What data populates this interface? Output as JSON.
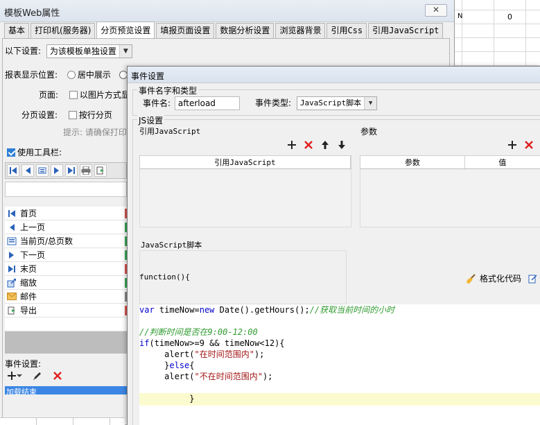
{
  "sheet": {
    "cell_a": "N",
    "cell_b": "0"
  },
  "props_window": {
    "title": "模板Web属性",
    "close_label": "✕",
    "tabs": [
      "基本",
      "打印机(服务器)",
      "分页预览设置",
      "填报页面设置",
      "数据分析设置",
      "浏览器背景",
      "引用Css",
      "引用JavaScript"
    ],
    "active_tab": "分页预览设置",
    "settings_label": "以下设置:",
    "settings_value": "为该模板单独设置",
    "position_label": "报表显示位置:",
    "position_option": "居中展示",
    "page_label": "页面:",
    "page_option": "以图片方式显",
    "paging_label": "分页设置:",
    "paging_option": "按行分页",
    "hint": "提示: 请确保打印",
    "use_toolbar_label": "使用工具栏:",
    "button_list": [
      {
        "label": "首页",
        "icon": "first-page-icon",
        "mark": "#d9534f"
      },
      {
        "label": "上一页",
        "icon": "prev-page-icon",
        "mark": "#3aa757"
      },
      {
        "label": "当前页/总页数",
        "icon": "page-count-icon",
        "mark": "#3aa757"
      },
      {
        "label": "下一页",
        "icon": "next-page-icon",
        "mark": "#3aa757"
      },
      {
        "label": "末页",
        "icon": "last-page-icon",
        "mark": "#d9534f"
      },
      {
        "label": "缩放",
        "icon": "zoom-icon",
        "mark": "#3aa757"
      },
      {
        "label": "邮件",
        "icon": "mail-icon",
        "mark": "#888888"
      },
      {
        "label": "导出",
        "icon": "export-icon",
        "mark": "#d9534f"
      }
    ],
    "event_label": "事件设置:",
    "event_selected": "加载结束"
  },
  "event_dialog": {
    "title": "事件设置",
    "name_type_group": "事件名字和类型",
    "event_name_label": "事件名:",
    "event_name_value": "afterload",
    "event_type_label": "事件类型:",
    "event_type_value": "JavaScript脚本",
    "js_group": "JS设置",
    "ref_js_label": "引用JavaScript",
    "params_label": "参数",
    "ref_js_column": "引用JavaScript",
    "param_column": "参数",
    "value_column": "值",
    "script_label": "JavaScript脚本",
    "function_header": "function(){",
    "format_code_label": "格式化代码"
  },
  "code_lines": [
    "var timeNow=new Date().getHours();//获取当前时间的小时",
    "",
    "//判断时间是否在9:00-12:00",
    "if(timeNow>=9 && timeNow<12){",
    "    alert(\"在时间范围内\");",
    "    }else{",
    "    alert(\"不在时间范围内\");",
    "",
    "        }"
  ]
}
